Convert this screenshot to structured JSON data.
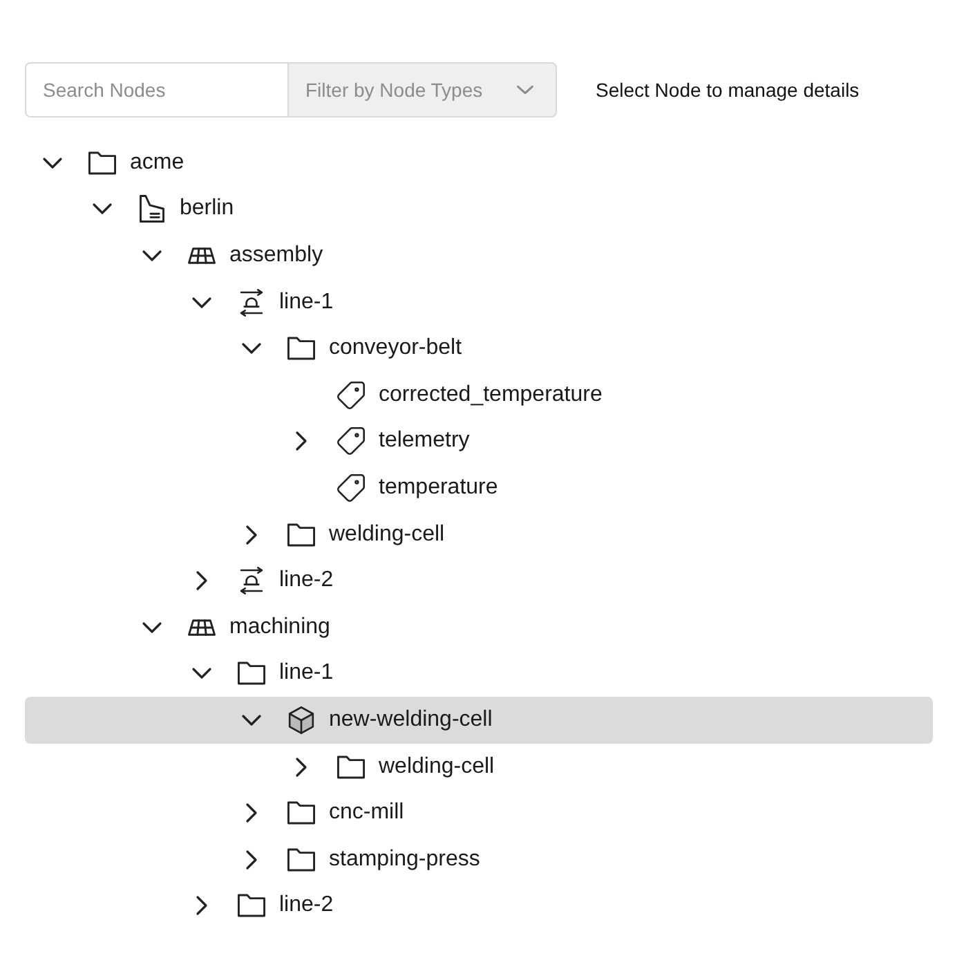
{
  "search": {
    "placeholder": "Search Nodes"
  },
  "filter": {
    "placeholder": "Filter by Node Types"
  },
  "hint": "Select Node to manage details",
  "tree": [
    {
      "label": "acme",
      "kind": "folder",
      "expanded": true,
      "selected": false,
      "children": [
        {
          "label": "berlin",
          "kind": "site",
          "expanded": true,
          "selected": false,
          "children": [
            {
              "label": "assembly",
              "kind": "area",
              "expanded": true,
              "selected": false,
              "children": [
                {
                  "label": "line-1",
                  "kind": "line",
                  "expanded": true,
                  "selected": false,
                  "children": [
                    {
                      "label": "conveyor-belt",
                      "kind": "folder",
                      "expanded": true,
                      "selected": false,
                      "children": [
                        {
                          "label": "corrected_temperature",
                          "kind": "tag",
                          "selected": false
                        },
                        {
                          "label": "telemetry",
                          "kind": "tag",
                          "expanded": false,
                          "selected": false
                        },
                        {
                          "label": "temperature",
                          "kind": "tag",
                          "selected": false
                        }
                      ]
                    },
                    {
                      "label": "welding-cell",
                      "kind": "folder",
                      "expanded": false,
                      "selected": false
                    }
                  ]
                },
                {
                  "label": "line-2",
                  "kind": "line",
                  "expanded": false,
                  "selected": false
                }
              ]
            },
            {
              "label": "machining",
              "kind": "area",
              "expanded": true,
              "selected": false,
              "children": [
                {
                  "label": "line-1",
                  "kind": "folder",
                  "expanded": true,
                  "selected": false,
                  "children": [
                    {
                      "label": "new-welding-cell",
                      "kind": "asset",
                      "expanded": true,
                      "selected": true,
                      "children": [
                        {
                          "label": "welding-cell",
                          "kind": "folder",
                          "expanded": false,
                          "selected": false
                        }
                      ]
                    },
                    {
                      "label": "cnc-mill",
                      "kind": "folder",
                      "expanded": false,
                      "selected": false
                    },
                    {
                      "label": "stamping-press",
                      "kind": "folder",
                      "expanded": false,
                      "selected": false
                    }
                  ]
                },
                {
                  "label": "line-2",
                  "kind": "folder",
                  "expanded": false,
                  "selected": false
                }
              ]
            }
          ]
        }
      ]
    }
  ]
}
